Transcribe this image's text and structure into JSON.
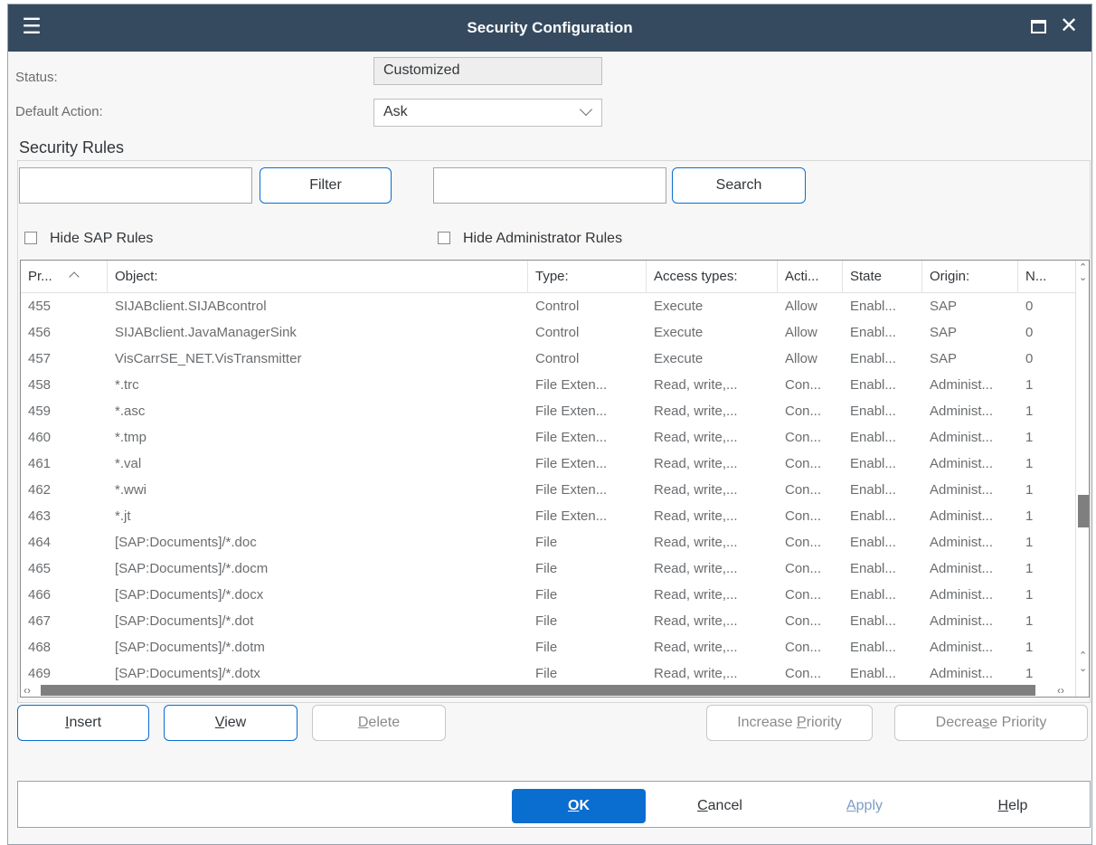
{
  "window": {
    "title": "Security Configuration"
  },
  "form": {
    "status_label": "Status:",
    "status_value": "Customized",
    "default_action_label": "Default Action:",
    "default_action_value": "Ask"
  },
  "rules": {
    "section_title": "Security Rules",
    "filter_input_value": "",
    "filter_button": "Filter",
    "search_input_value": "",
    "search_button": "Search",
    "hide_sap_rules": "Hide SAP Rules",
    "hide_admin_rules": "Hide Administrator Rules"
  },
  "table": {
    "columns": [
      "Pr...",
      "Object:",
      "Type:",
      "Access types:",
      "Acti...",
      "State",
      "Origin:",
      "N..."
    ],
    "rows": [
      [
        "455",
        "SIJABclient.SIJABcontrol",
        "Control",
        "Execute",
        "Allow",
        "Enabl...",
        "SAP",
        "0"
      ],
      [
        "456",
        "SIJABclient.JavaManagerSink",
        "Control",
        "Execute",
        "Allow",
        "Enabl...",
        "SAP",
        "0"
      ],
      [
        "457",
        "VisCarrSE_NET.VisTransmitter",
        "Control",
        "Execute",
        "Allow",
        "Enabl...",
        "SAP",
        "0"
      ],
      [
        "458",
        "*.trc",
        "File Exten...",
        "Read, write,...",
        "Con...",
        "Enabl...",
        "Administ...",
        "1"
      ],
      [
        "459",
        "*.asc",
        "File Exten...",
        "Read, write,...",
        "Con...",
        "Enabl...",
        "Administ...",
        "1"
      ],
      [
        "460",
        "*.tmp",
        "File Exten...",
        "Read, write,...",
        "Con...",
        "Enabl...",
        "Administ...",
        "1"
      ],
      [
        "461",
        "*.val",
        "File Exten...",
        "Read, write,...",
        "Con...",
        "Enabl...",
        "Administ...",
        "1"
      ],
      [
        "462",
        "*.wwi",
        "File Exten...",
        "Read, write,...",
        "Con...",
        "Enabl...",
        "Administ...",
        "1"
      ],
      [
        "463",
        "*.jt",
        "File Exten...",
        "Read, write,...",
        "Con...",
        "Enabl...",
        "Administ...",
        "1"
      ],
      [
        "464",
        "[SAP:Documents]/*.doc",
        "File",
        "Read, write,...",
        "Con...",
        "Enabl...",
        "Administ...",
        "1"
      ],
      [
        "465",
        "[SAP:Documents]/*.docm",
        "File",
        "Read, write,...",
        "Con...",
        "Enabl...",
        "Administ...",
        "1"
      ],
      [
        "466",
        "[SAP:Documents]/*.docx",
        "File",
        "Read, write,...",
        "Con...",
        "Enabl...",
        "Administ...",
        "1"
      ],
      [
        "467",
        "[SAP:Documents]/*.dot",
        "File",
        "Read, write,...",
        "Con...",
        "Enabl...",
        "Administ...",
        "1"
      ],
      [
        "468",
        "[SAP:Documents]/*.dotm",
        "File",
        "Read, write,...",
        "Con...",
        "Enabl...",
        "Administ...",
        "1"
      ],
      [
        "469",
        "[SAP:Documents]/*.dotx",
        "File",
        "Read, write,...",
        "Con...",
        "Enabl...",
        "Administ...",
        "1"
      ]
    ]
  },
  "actions": {
    "insert_accel": "I",
    "insert_rest": "nsert",
    "view_accel": "V",
    "view_rest": "iew",
    "delete_accel": "D",
    "delete_rest": "elete",
    "increase_pre": "Increase ",
    "increase_accel": "P",
    "increase_post": "riority",
    "decrease_pre": "Decrea",
    "decrease_accel": "s",
    "decrease_post": "e Priority"
  },
  "footer": {
    "ok_accel": "O",
    "ok_rest": "K",
    "cancel_accel": "C",
    "cancel_rest": "ancel",
    "apply_accel": "A",
    "apply_rest": "pply",
    "help_accel": "H",
    "help_rest": "elp"
  },
  "icons": {
    "menu": "hamburger-icon",
    "maximize": "maximize-icon",
    "close": "close-icon",
    "dropdown": "chevron-down-icon",
    "sort": "chevron-up-icon"
  },
  "colors": {
    "titlebar": "#354a5f",
    "accent": "#0a6ed1",
    "scroll_thumb": "#7f7f7f"
  }
}
